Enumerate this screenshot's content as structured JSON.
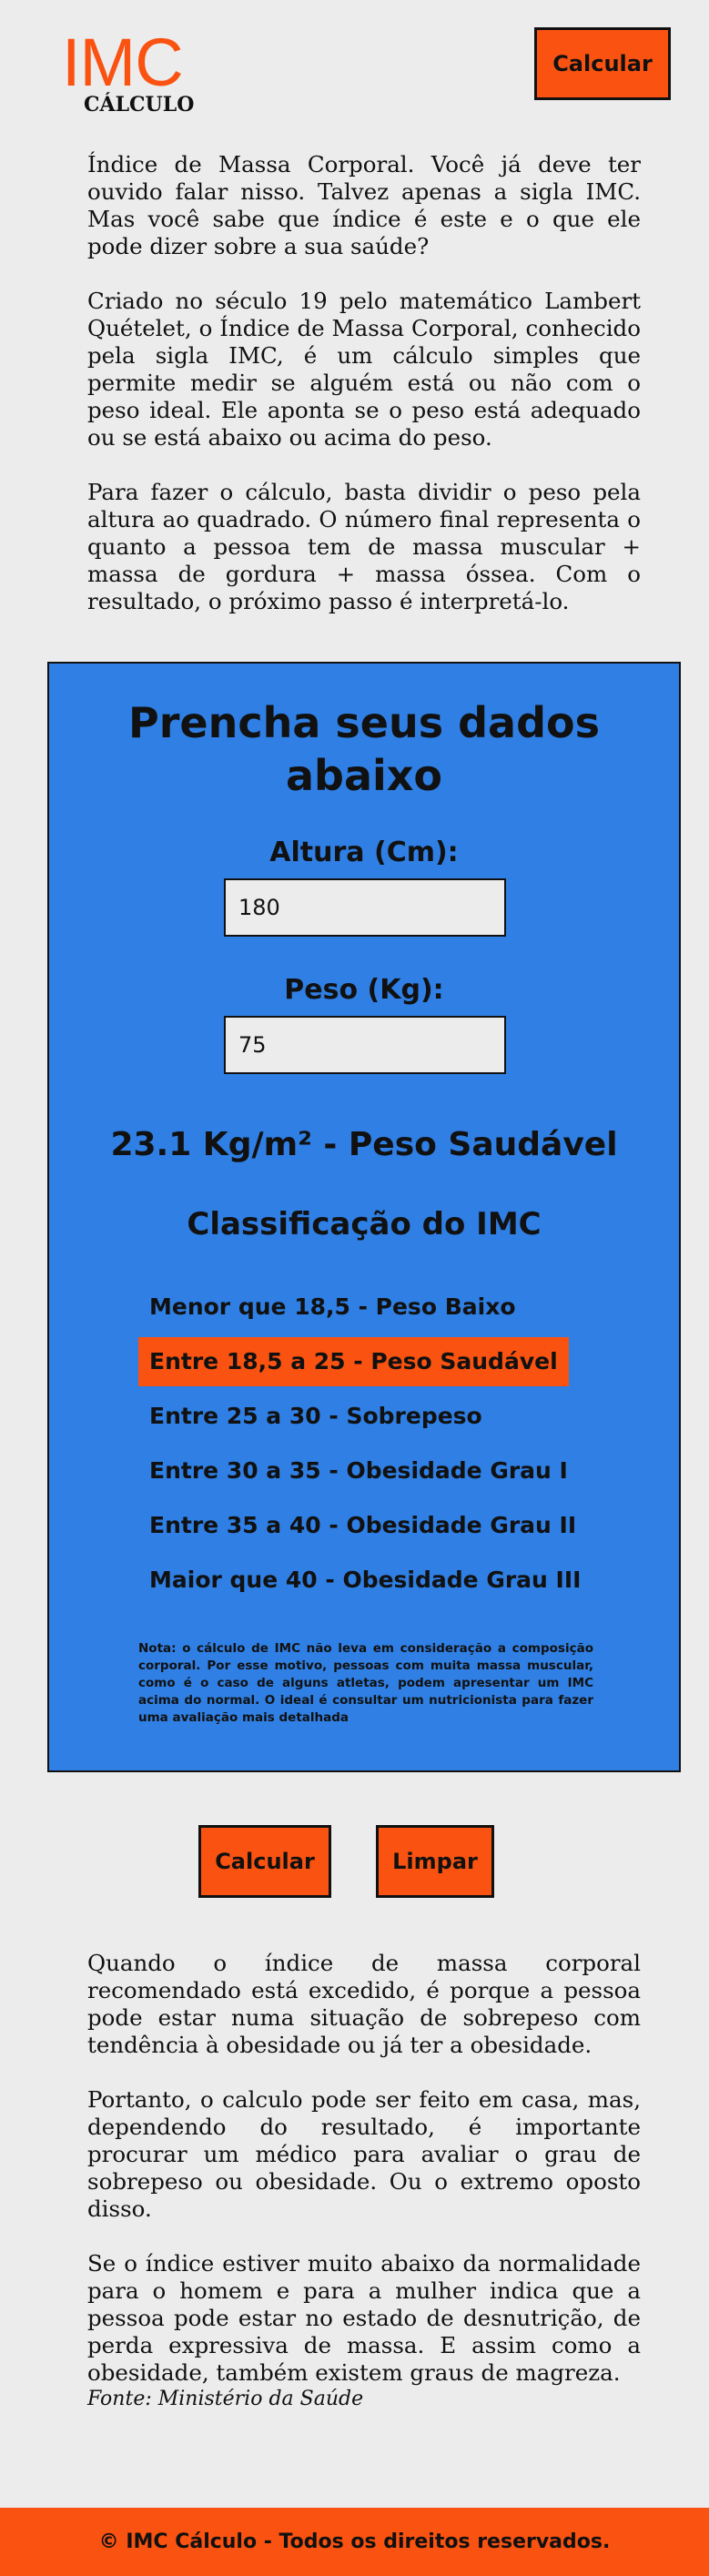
{
  "header": {
    "logo_main": "IMC",
    "logo_sub": "CÁLCULO",
    "calc_button": "Calcular"
  },
  "intro": {
    "p1": "Índice de Massa Corporal. Você já deve ter ouvido falar nisso. Talvez apenas a sigla IMC. Mas você sabe que índice é este e o que ele pode dizer sobre a sua saúde?",
    "p2": "Criado no século 19 pelo matemático Lambert Quételet, o Índice de Massa Corporal, conhecido pela sigla IMC, é um cálculo simples que permite medir se alguém está ou não com o peso ideal. Ele aponta se o peso está adequado ou se está abaixo ou acima do peso.",
    "p3": "Para fazer o cálculo, basta dividir o peso pela altura ao quadrado. O número final representa o quanto a pessoa tem de massa muscular + massa de gordura + massa óssea. Com o resultado, o próximo passo é interpretá-lo."
  },
  "form": {
    "title": "Prencha seus dados abaixo",
    "height_label": "Altura (Cm):",
    "height_value": "180",
    "weight_label": "Peso (Kg):",
    "weight_value": "75",
    "result": "23.1 Kg/m² - Peso Saudável",
    "classification_title": "Classificação do IMC",
    "classifications": [
      {
        "label": "Menor que 18,5 - Peso Baixo",
        "active": false
      },
      {
        "label": "Entre 18,5 a 25 - Peso Saudável",
        "active": true
      },
      {
        "label": "Entre 25 a 30 - Sobrepeso",
        "active": false
      },
      {
        "label": "Entre 30 a 35 - Obesidade Grau I",
        "active": false
      },
      {
        "label": "Entre 35 a 40 - Obesidade Grau II",
        "active": false
      },
      {
        "label": "Maior que 40 - Obesidade Grau III",
        "active": false
      }
    ],
    "note": "Nota: o cálculo de IMC não leva em consideração a composição corporal. Por esse motivo, pessoas com muita massa muscular, como é o caso de alguns atletas, podem apresentar um IMC acima do normal. O ideal é consultar um nutricionista para fazer uma avaliação mais detalhada"
  },
  "actions": {
    "calc_label": "Calcular",
    "clear_label": "Limpar"
  },
  "outro": {
    "p1": "Quando o índice de massa corporal recomendado está excedido, é porque a pessoa pode estar numa situação de sobrepeso com tendência à obesidade ou já ter a obesidade.",
    "p2": "Portanto, o calculo pode ser feito em casa, mas, dependendo do resultado, é importante procurar um médico para avaliar o grau de sobrepeso ou obesidade. Ou o extremo oposto disso.",
    "p3": "Se o índice estiver muito abaixo da normalidade para o homem e para a mulher indica que a pessoa pode estar no estado de desnutrição, de perda expressiva de massa. E assim como a obesidade, também existem graus de magreza.",
    "source": "Fonte: Ministério da Saúde"
  },
  "footer": {
    "text": "© IMC Cálculo - Todos os direitos reservados."
  },
  "colors": {
    "accent": "#fa5210",
    "panel": "#2f7fe4",
    "background": "#ececec"
  }
}
